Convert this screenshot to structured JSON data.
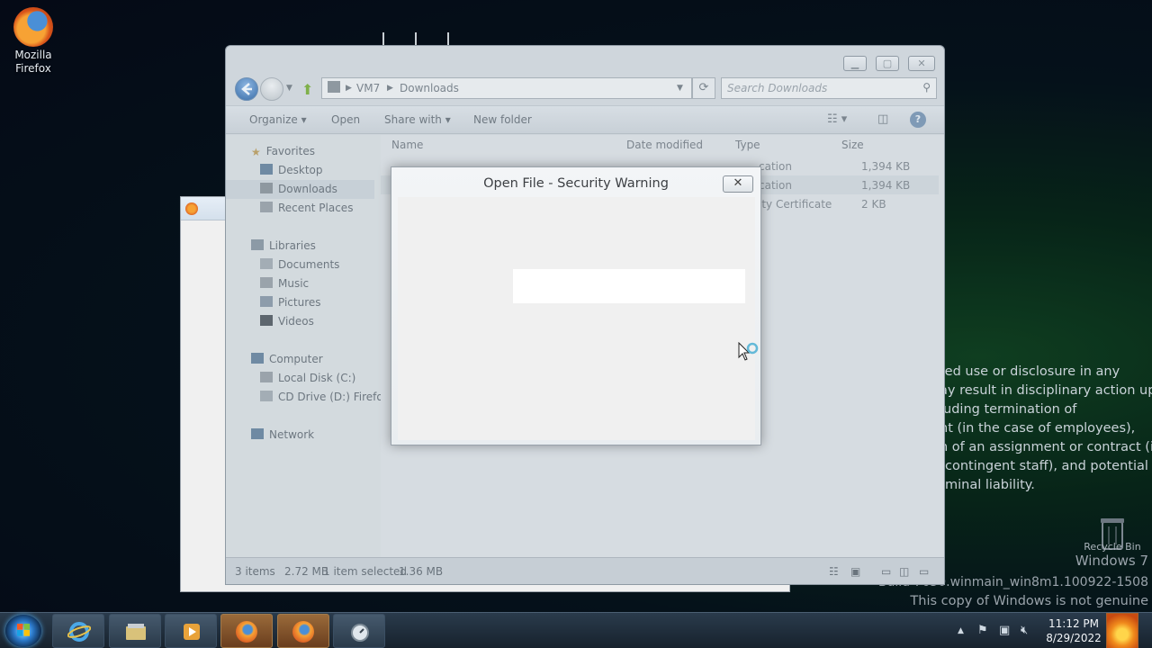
{
  "desktop": {
    "firefox_icon_label": "Mozilla Firefox",
    "recycle_bin_label": "Recycle Bin",
    "legal_notice_lines": [
      "ted use or disclosure in any",
      "ay result in disciplinary action up",
      "luding termination of",
      "nt (in the case of employees),",
      "n of an assignment or contract (in",
      "contingent staff), and potential",
      "minal liability."
    ],
    "windows_brand": "Windows 7",
    "build_line": "Build 7650.winmain_win8m1.100922-1508",
    "genuine_line": "This copy of Windows is not genuine"
  },
  "explorer": {
    "breadcrumb": [
      "VM7",
      "Downloads"
    ],
    "search_placeholder": "Search Downloads",
    "commands": {
      "organize": "Organize",
      "open": "Open",
      "share_with": "Share with",
      "new_folder": "New folder"
    },
    "nav": {
      "favorites": "Favorites",
      "desktop": "Desktop",
      "downloads": "Downloads",
      "recent_places": "Recent Places",
      "libraries": "Libraries",
      "documents": "Documents",
      "music": "Music",
      "pictures": "Pictures",
      "videos": "Videos",
      "computer": "Computer",
      "local_disk": "Local Disk (C:)",
      "cd_drive": "CD Drive (D:) Firefox",
      "network": "Network"
    },
    "columns": {
      "name": "Name",
      "date_modified": "Date modified",
      "type": "Type",
      "size": "Size"
    },
    "rows": [
      {
        "type": "cation",
        "size": "1,394 KB"
      },
      {
        "type": "cation",
        "size": "1,394 KB"
      },
      {
        "type": "ity Certificate",
        "size": "2 KB"
      }
    ],
    "status": {
      "items": "3 items",
      "total_size": "2.72 MB",
      "selected": "1 item selected",
      "selected_size": "1.36 MB"
    }
  },
  "dialog": {
    "title": "Open File - Security Warning",
    "close_glyph": "✕"
  },
  "taskbar": {
    "clock_time": "11:12 PM",
    "clock_date": "8/29/2022"
  },
  "colors": {
    "accent": "#2b78c8",
    "taskbar_active": "#9a6a3a"
  }
}
